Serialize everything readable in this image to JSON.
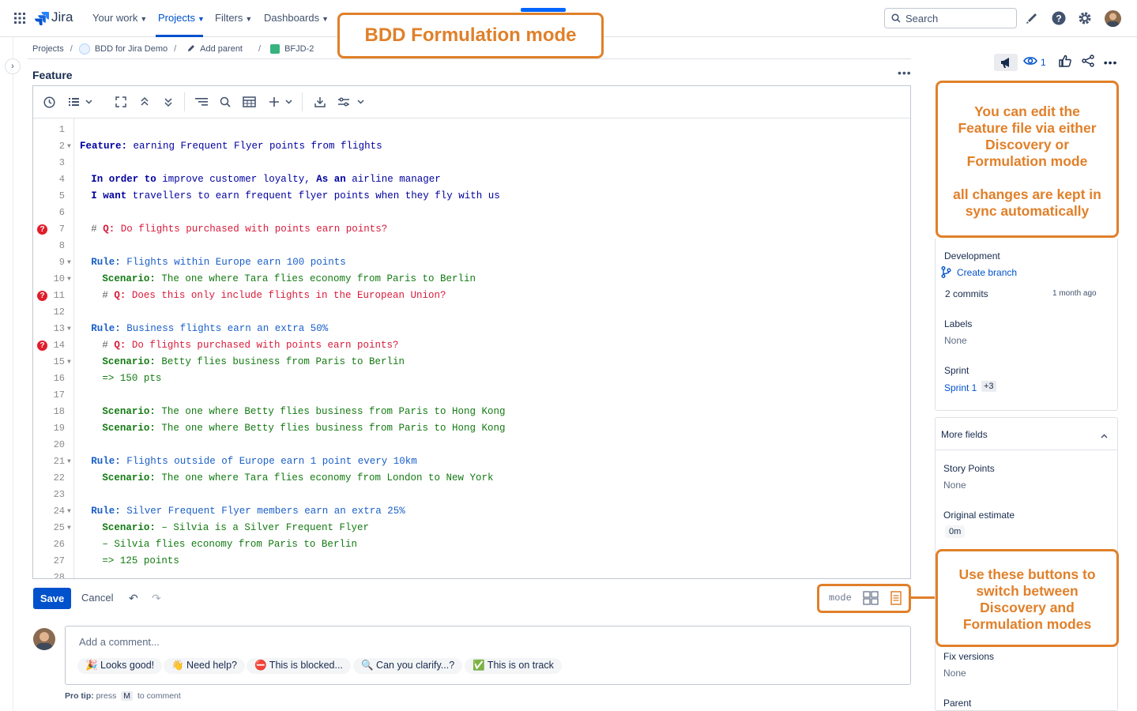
{
  "nav": {
    "logo": "Jira",
    "items": [
      "Your work",
      "Projects",
      "Filters",
      "Dashboards"
    ],
    "search_placeholder": "Search"
  },
  "breadcrumb": {
    "projects": "Projects",
    "project": "BDD for Jira Demo",
    "add_parent": "Add parent",
    "issue_key": "BFJD-2"
  },
  "editor": {
    "title": "Feature",
    "lines": [
      {
        "n": "1",
        "fold": false,
        "q": false,
        "indent": 0,
        "parts": []
      },
      {
        "n": "2",
        "fold": true,
        "q": false,
        "indent": 0,
        "parts": [
          [
            "kw-feat",
            "Feature:"
          ],
          [
            "t-feat",
            " earning Frequent Flyer points from flights"
          ]
        ]
      },
      {
        "n": "3",
        "fold": false,
        "q": false,
        "indent": 0,
        "parts": []
      },
      {
        "n": "4",
        "fold": false,
        "q": false,
        "indent": 2,
        "parts": [
          [
            "kw-feat",
            "In order to"
          ],
          [
            "t-feat",
            " improve customer loyalty, "
          ],
          [
            "kw-feat",
            "As an"
          ],
          [
            "t-feat",
            " airline manager"
          ]
        ]
      },
      {
        "n": "5",
        "fold": false,
        "q": false,
        "indent": 2,
        "parts": [
          [
            "kw-feat",
            "I want"
          ],
          [
            "t-feat",
            " travellers to earn frequent flyer points when they fly with us"
          ]
        ]
      },
      {
        "n": "6",
        "fold": false,
        "q": false,
        "indent": 0,
        "parts": []
      },
      {
        "n": "7",
        "fold": false,
        "q": true,
        "indent": 2,
        "parts": [
          [
            "t-hash",
            "# "
          ],
          [
            "kw-q",
            "Q:"
          ],
          [
            "t-q",
            " Do flights purchased with points earn points?"
          ]
        ]
      },
      {
        "n": "8",
        "fold": false,
        "q": false,
        "indent": 0,
        "parts": []
      },
      {
        "n": "9",
        "fold": true,
        "q": false,
        "indent": 2,
        "parts": [
          [
            "kw-rule",
            "Rule:"
          ],
          [
            "t-rule",
            " Flights within Europe earn 100 points"
          ]
        ]
      },
      {
        "n": "10",
        "fold": true,
        "q": false,
        "indent": 4,
        "parts": [
          [
            "kw-scen",
            "Scenario:"
          ],
          [
            "t-scen",
            " The one where Tara flies economy from Paris to Berlin"
          ]
        ]
      },
      {
        "n": "11",
        "fold": false,
        "q": true,
        "indent": 4,
        "parts": [
          [
            "t-hash",
            "# "
          ],
          [
            "kw-q",
            "Q:"
          ],
          [
            "t-q",
            " Does this only include flights in the European Union?"
          ]
        ]
      },
      {
        "n": "12",
        "fold": false,
        "q": false,
        "indent": 0,
        "parts": []
      },
      {
        "n": "13",
        "fold": true,
        "q": false,
        "indent": 2,
        "parts": [
          [
            "kw-rule",
            "Rule:"
          ],
          [
            "t-rule",
            " Business flights earn an extra 50%"
          ]
        ]
      },
      {
        "n": "14",
        "fold": false,
        "q": true,
        "indent": 4,
        "parts": [
          [
            "t-hash",
            "# "
          ],
          [
            "kw-q",
            "Q:"
          ],
          [
            "t-q",
            " Do flights purchased with points earn points?"
          ]
        ]
      },
      {
        "n": "15",
        "fold": true,
        "q": false,
        "indent": 4,
        "parts": [
          [
            "kw-scen",
            "Scenario:"
          ],
          [
            "t-scen",
            " Betty flies business from Paris to Berlin"
          ]
        ]
      },
      {
        "n": "16",
        "fold": false,
        "q": false,
        "indent": 4,
        "parts": [
          [
            "t-scen",
            "=> 150 pts"
          ]
        ]
      },
      {
        "n": "17",
        "fold": false,
        "q": false,
        "indent": 0,
        "parts": []
      },
      {
        "n": "18",
        "fold": false,
        "q": false,
        "indent": 4,
        "parts": [
          [
            "kw-scen",
            "Scenario:"
          ],
          [
            "t-scen",
            " The one where Betty flies business from Paris to Hong Kong"
          ]
        ]
      },
      {
        "n": "19",
        "fold": false,
        "q": false,
        "indent": 4,
        "parts": [
          [
            "kw-scen",
            "Scenario:"
          ],
          [
            "t-scen",
            " The one where Betty flies business from Paris to Hong Kong"
          ]
        ]
      },
      {
        "n": "20",
        "fold": false,
        "q": false,
        "indent": 0,
        "parts": []
      },
      {
        "n": "21",
        "fold": true,
        "q": false,
        "indent": 2,
        "parts": [
          [
            "kw-rule",
            "Rule:"
          ],
          [
            "t-rule",
            " Flights outside of Europe earn 1 point every 10km"
          ]
        ]
      },
      {
        "n": "22",
        "fold": false,
        "q": false,
        "indent": 4,
        "parts": [
          [
            "kw-scen",
            "Scenario:"
          ],
          [
            "t-scen",
            " The one where Tara flies economy from London to New York"
          ]
        ]
      },
      {
        "n": "23",
        "fold": false,
        "q": false,
        "indent": 0,
        "parts": []
      },
      {
        "n": "24",
        "fold": true,
        "q": false,
        "indent": 2,
        "parts": [
          [
            "kw-rule",
            "Rule:"
          ],
          [
            "t-rule",
            " Silver Frequent Flyer members earn an extra 25%"
          ]
        ]
      },
      {
        "n": "25",
        "fold": true,
        "q": false,
        "indent": 4,
        "parts": [
          [
            "kw-scen",
            "Scenario:"
          ],
          [
            "t-scen",
            " – Silvia is a Silver Frequent Flyer"
          ]
        ]
      },
      {
        "n": "26",
        "fold": false,
        "q": false,
        "indent": 4,
        "parts": [
          [
            "t-scen",
            "– Silvia flies economy from Paris to Berlin"
          ]
        ]
      },
      {
        "n": "27",
        "fold": false,
        "q": false,
        "indent": 4,
        "parts": [
          [
            "t-scen",
            "=> 125 points"
          ]
        ]
      },
      {
        "n": "28",
        "fold": false,
        "q": false,
        "indent": 0,
        "parts": []
      }
    ],
    "save_label": "Save",
    "cancel_label": "Cancel",
    "mode_label": "mode"
  },
  "comment": {
    "placeholder": "Add a comment...",
    "chips": [
      "🎉 Looks good!",
      "👋 Need help?",
      "⛔ This is blocked...",
      "🔍 Can you clarify...?",
      "✅ This is on track"
    ],
    "pro_tip_label": "Pro tip:",
    "pro_tip_press": "press",
    "pro_tip_key": "M",
    "pro_tip_rest": "to comment"
  },
  "right_panel": {
    "watch_count": "1",
    "development_label": "Development",
    "create_branch": "Create branch",
    "commits": "2 commits",
    "commits_time": "1 month ago",
    "labels_label": "Labels",
    "labels_value": "None",
    "sprint_label": "Sprint",
    "sprint_value": "Sprint 1",
    "sprint_extra": "+3",
    "more_fields": "More fields",
    "story_points_label": "Story Points",
    "story_points_value": "None",
    "original_estimate_label": "Original estimate",
    "original_estimate_value": "0m",
    "fix_versions_label": "Fix versions",
    "fix_versions_value": "None",
    "parent_label": "Parent"
  },
  "annotations": {
    "title": "BDD Formulation mode",
    "edit_line1": "You can edit the Feature file via either Discovery or Formulation mode",
    "edit_line2": "all changes are kept in sync automatically",
    "switch": "Use these buttons to switch between Discovery and Formulation modes"
  },
  "colors": {
    "accent": "#0052cc",
    "annotation": "#e0802a",
    "question": "#d81b3a"
  }
}
